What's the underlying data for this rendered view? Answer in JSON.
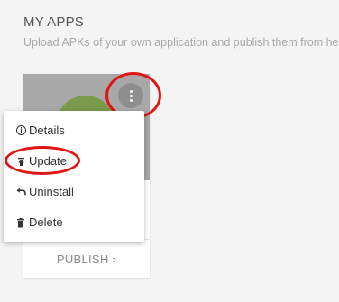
{
  "section": {
    "title": "MY APPS",
    "subtitle": "Upload APKs of your own application and publish them from here"
  },
  "card": {
    "publish_label": "PUBLISH ›"
  },
  "menu": {
    "items": [
      {
        "label": "Details",
        "icon": "info-icon"
      },
      {
        "label": "Update",
        "icon": "upload-icon"
      },
      {
        "label": "Uninstall",
        "icon": "undo-icon"
      },
      {
        "label": "Delete",
        "icon": "trash-icon"
      }
    ]
  },
  "colors": {
    "highlight": "#e01515",
    "menu_background": "#ffffff",
    "page_background": "#f4f4f4"
  }
}
